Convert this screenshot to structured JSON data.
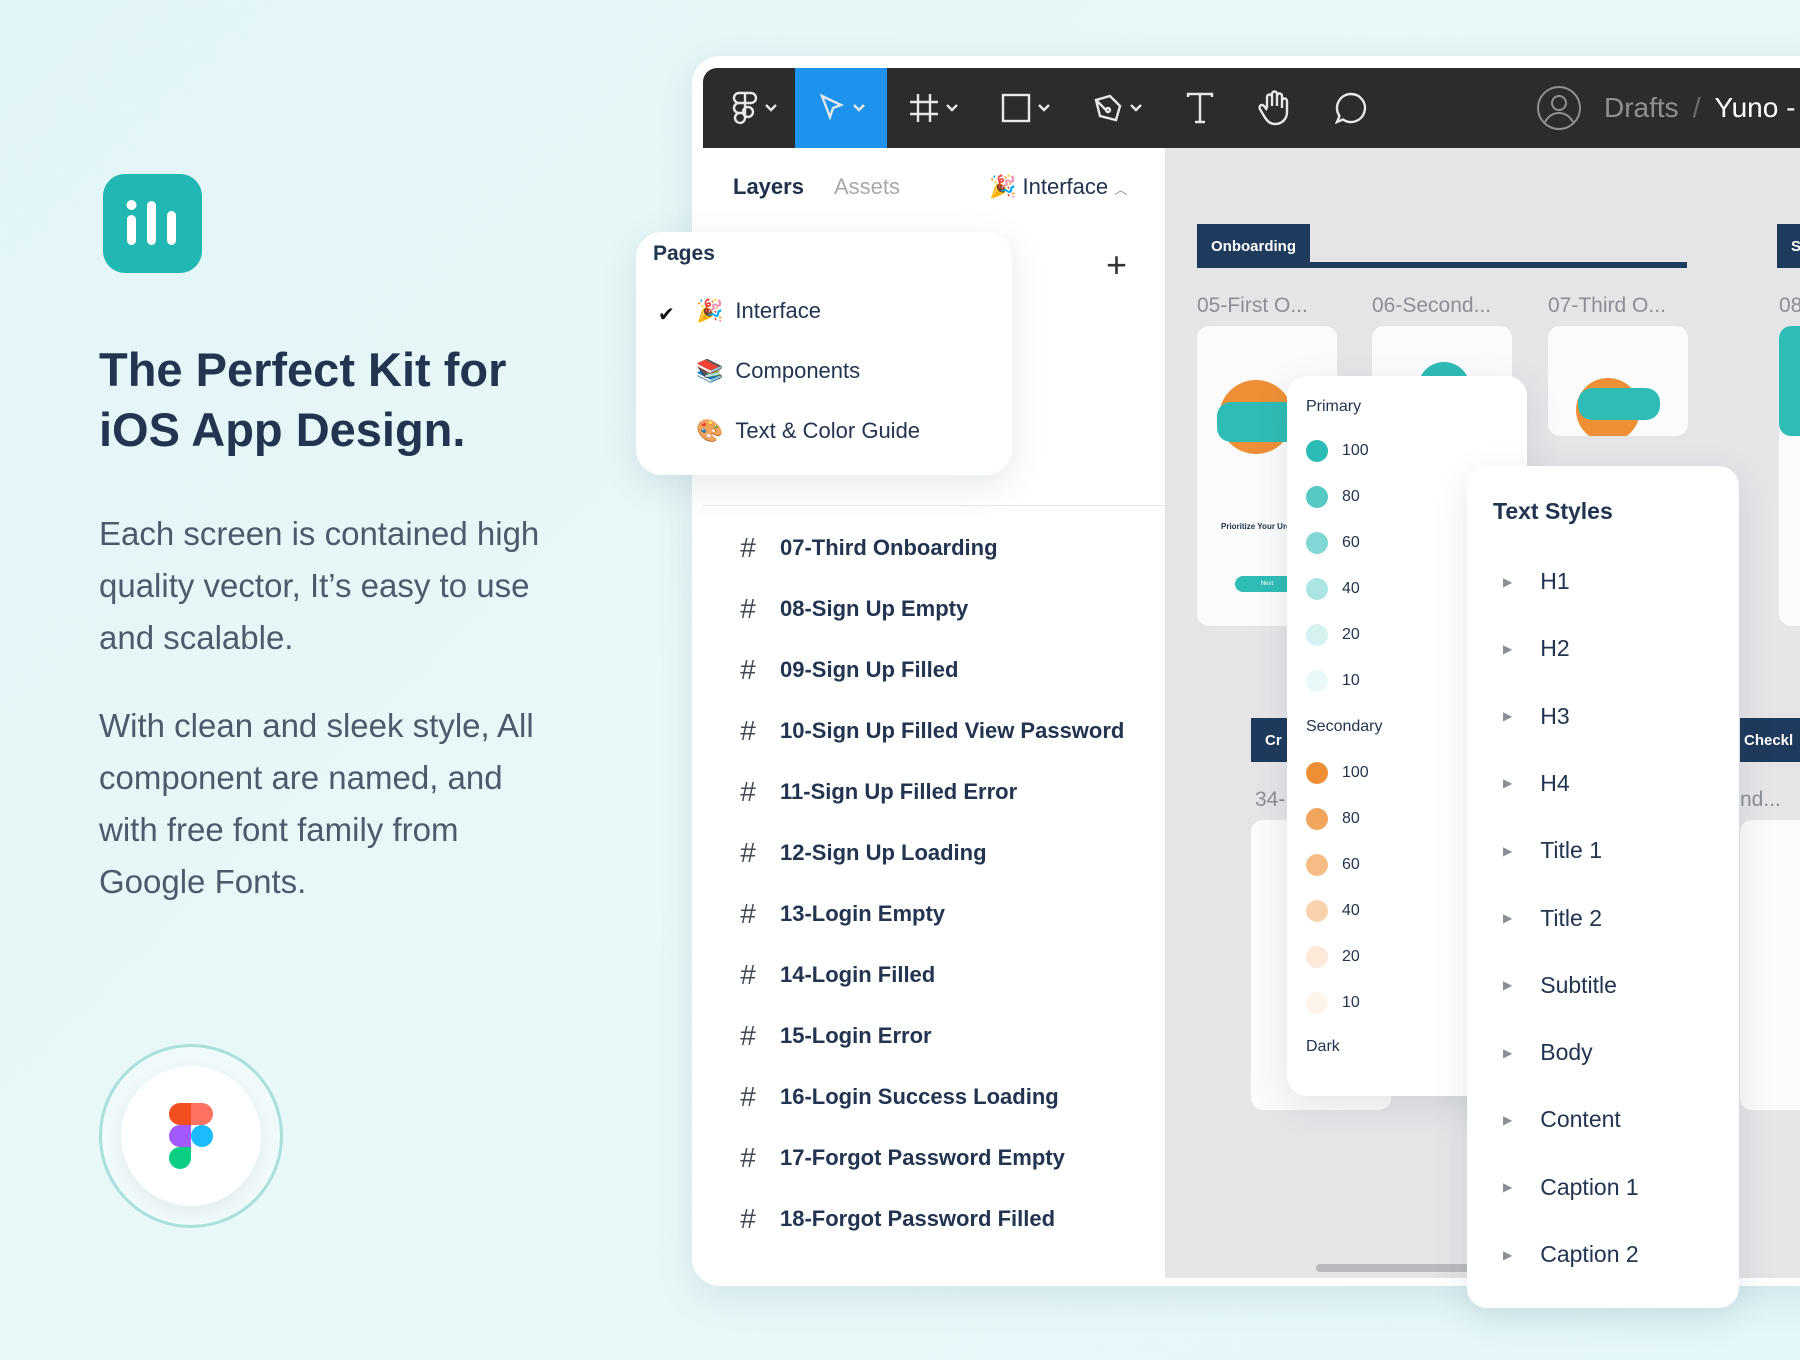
{
  "promo": {
    "headline": "The Perfect Kit for iOS App Design.",
    "paragraph1": "Each screen is contained high quality vector, It’s easy to use and scalable.",
    "paragraph2": "With clean and sleek style, All component are named, and with free font family from Google Fonts.",
    "brand_color": "#21b8b3"
  },
  "toolbar": {
    "tools": [
      "figma-menu",
      "move",
      "frame",
      "rectangle",
      "pen",
      "text",
      "hand",
      "comment"
    ],
    "active_tool": "move",
    "active_color": "#1d93ed",
    "breadcrumb_folder": "Drafts",
    "breadcrumb_separator": "/",
    "breadcrumb_file": "Yuno -"
  },
  "left_panel": {
    "tab_layers": "Layers",
    "tab_assets": "Assets",
    "current_page": "Interface",
    "current_page_emoji": "🎉",
    "add_page": "+",
    "layers": [
      "07-Third Onboarding",
      "08-Sign Up Empty",
      "09-Sign Up Filled",
      "10-Sign Up Filled View Password",
      "11-Sign Up Filled Error",
      "12-Sign Up Loading",
      "13-Login Empty",
      "14-Login Filled",
      "15-Login Error",
      "16-Login Success Loading",
      "17-Forgot Password Empty",
      "18-Forgot Password Filled"
    ]
  },
  "pages_popup": {
    "title": "Pages",
    "items": [
      {
        "emoji": "🎉",
        "label": "Interface",
        "selected": true
      },
      {
        "emoji": "📚",
        "label": "Components",
        "selected": false
      },
      {
        "emoji": "🎨",
        "label": "Text & Color Guide",
        "selected": false
      }
    ]
  },
  "canvas": {
    "section_onboarding": "Onboarding",
    "section_right": "S",
    "section_cr": "Cr",
    "section_checklist": "Checkl",
    "frames": [
      "05-First O...",
      "06-Second...",
      "07-Third O...",
      "08"
    ],
    "frame_34": "34-",
    "frame_nd": "nd...",
    "phone_caption": "Prioritize Your Urge",
    "phone_button": "Next"
  },
  "color_popup": {
    "primary_label": "Primary",
    "primary_color": "#2cbcb6",
    "secondary_label": "Secondary",
    "secondary_color": "#ef8f35",
    "dark_label": "Dark",
    "levels": [
      "100",
      "80",
      "60",
      "40",
      "20",
      "10"
    ],
    "level_opacity": [
      1,
      0.8,
      0.6,
      0.4,
      0.2,
      0.1
    ]
  },
  "text_styles": {
    "title": "Text Styles",
    "items": [
      "H1",
      "H2",
      "H3",
      "H4",
      "Title 1",
      "Title 2",
      "Subtitle",
      "Body",
      "Content",
      "Caption 1",
      "Caption 2"
    ]
  }
}
